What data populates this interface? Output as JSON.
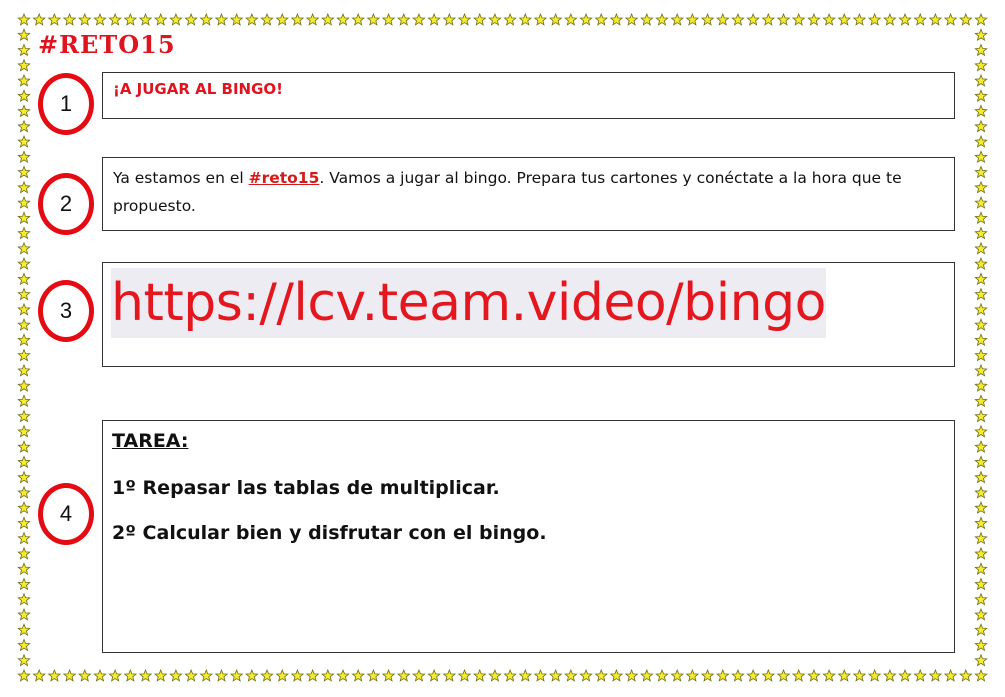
{
  "title": "#RETO15",
  "steps": [
    {
      "number": "1"
    },
    {
      "number": "2"
    },
    {
      "number": "3"
    },
    {
      "number": "4"
    }
  ],
  "box1": {
    "text": "¡A JUGAR AL BINGO!"
  },
  "box2": {
    "text_before": "Ya estamos en el ",
    "tag": "#reto15",
    "text_after": ".  Vamos a jugar al bingo. Prepara tus cartones y conéctate a la hora que te propuesto."
  },
  "box3": {
    "link": "https://lcv.team.video/bingo"
  },
  "box4": {
    "heading": "TAREA:",
    "items": [
      "1º Repasar las tablas de multiplicar.",
      "2º Calcular bien y disfrutar con el bingo."
    ]
  },
  "colors": {
    "accent_red": "#e0141e",
    "circle_red": "#e50b13",
    "star_fill": "#f6ec2e",
    "star_stroke": "#6b6b1a",
    "link_highlight": "#ececf2"
  },
  "decoration": {
    "border_icon": "star-icon"
  }
}
